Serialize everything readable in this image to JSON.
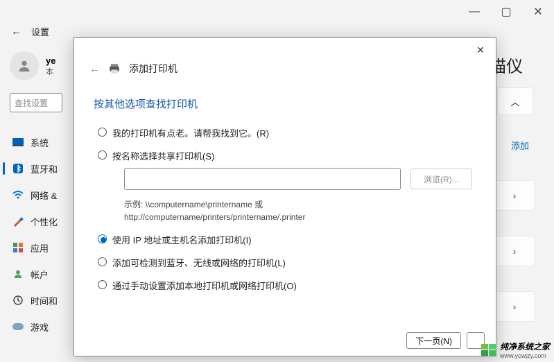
{
  "titlebar": {
    "min": "—",
    "max": "▢",
    "close": "✕"
  },
  "header": {
    "back": "←",
    "title": "设置"
  },
  "user": {
    "name": "ye",
    "local": "本"
  },
  "search_placeholder": "查找设置",
  "nav": [
    {
      "label": "系统"
    },
    {
      "label": "蓝牙和"
    },
    {
      "label": "网络 &"
    },
    {
      "label": "个性化"
    },
    {
      "label": "应用"
    },
    {
      "label": "帐户"
    },
    {
      "label": "时间和"
    },
    {
      "label": "游戏"
    }
  ],
  "content_title_suffix": "描仪",
  "right_expand": "︿",
  "right_add": "添加",
  "right_chevron": "›",
  "modal": {
    "back": "←",
    "title": "添加打印机",
    "subtitle": "按其他选项查找打印机",
    "options": {
      "old": "我的打印机有点老。请帮我找到它。(R)",
      "byname": "按名称选择共享打印机(S)",
      "browse": "浏览(R)...",
      "example_l1": "示例: \\\\computername\\printername 或",
      "example_l2": "http://computername/printers/printername/.printer",
      "ip": "使用 IP 地址或主机名添加打印机(I)",
      "wireless": "添加可检测到蓝牙、无线或网络的打印机(L)",
      "manual": "通过手动设置添加本地打印机或网络打印机(O)"
    },
    "next_btn": "下一页(N)",
    "close": "✕"
  },
  "watermark": {
    "text": "纯净系统之家",
    "url": "www.ycwjzy.com"
  }
}
